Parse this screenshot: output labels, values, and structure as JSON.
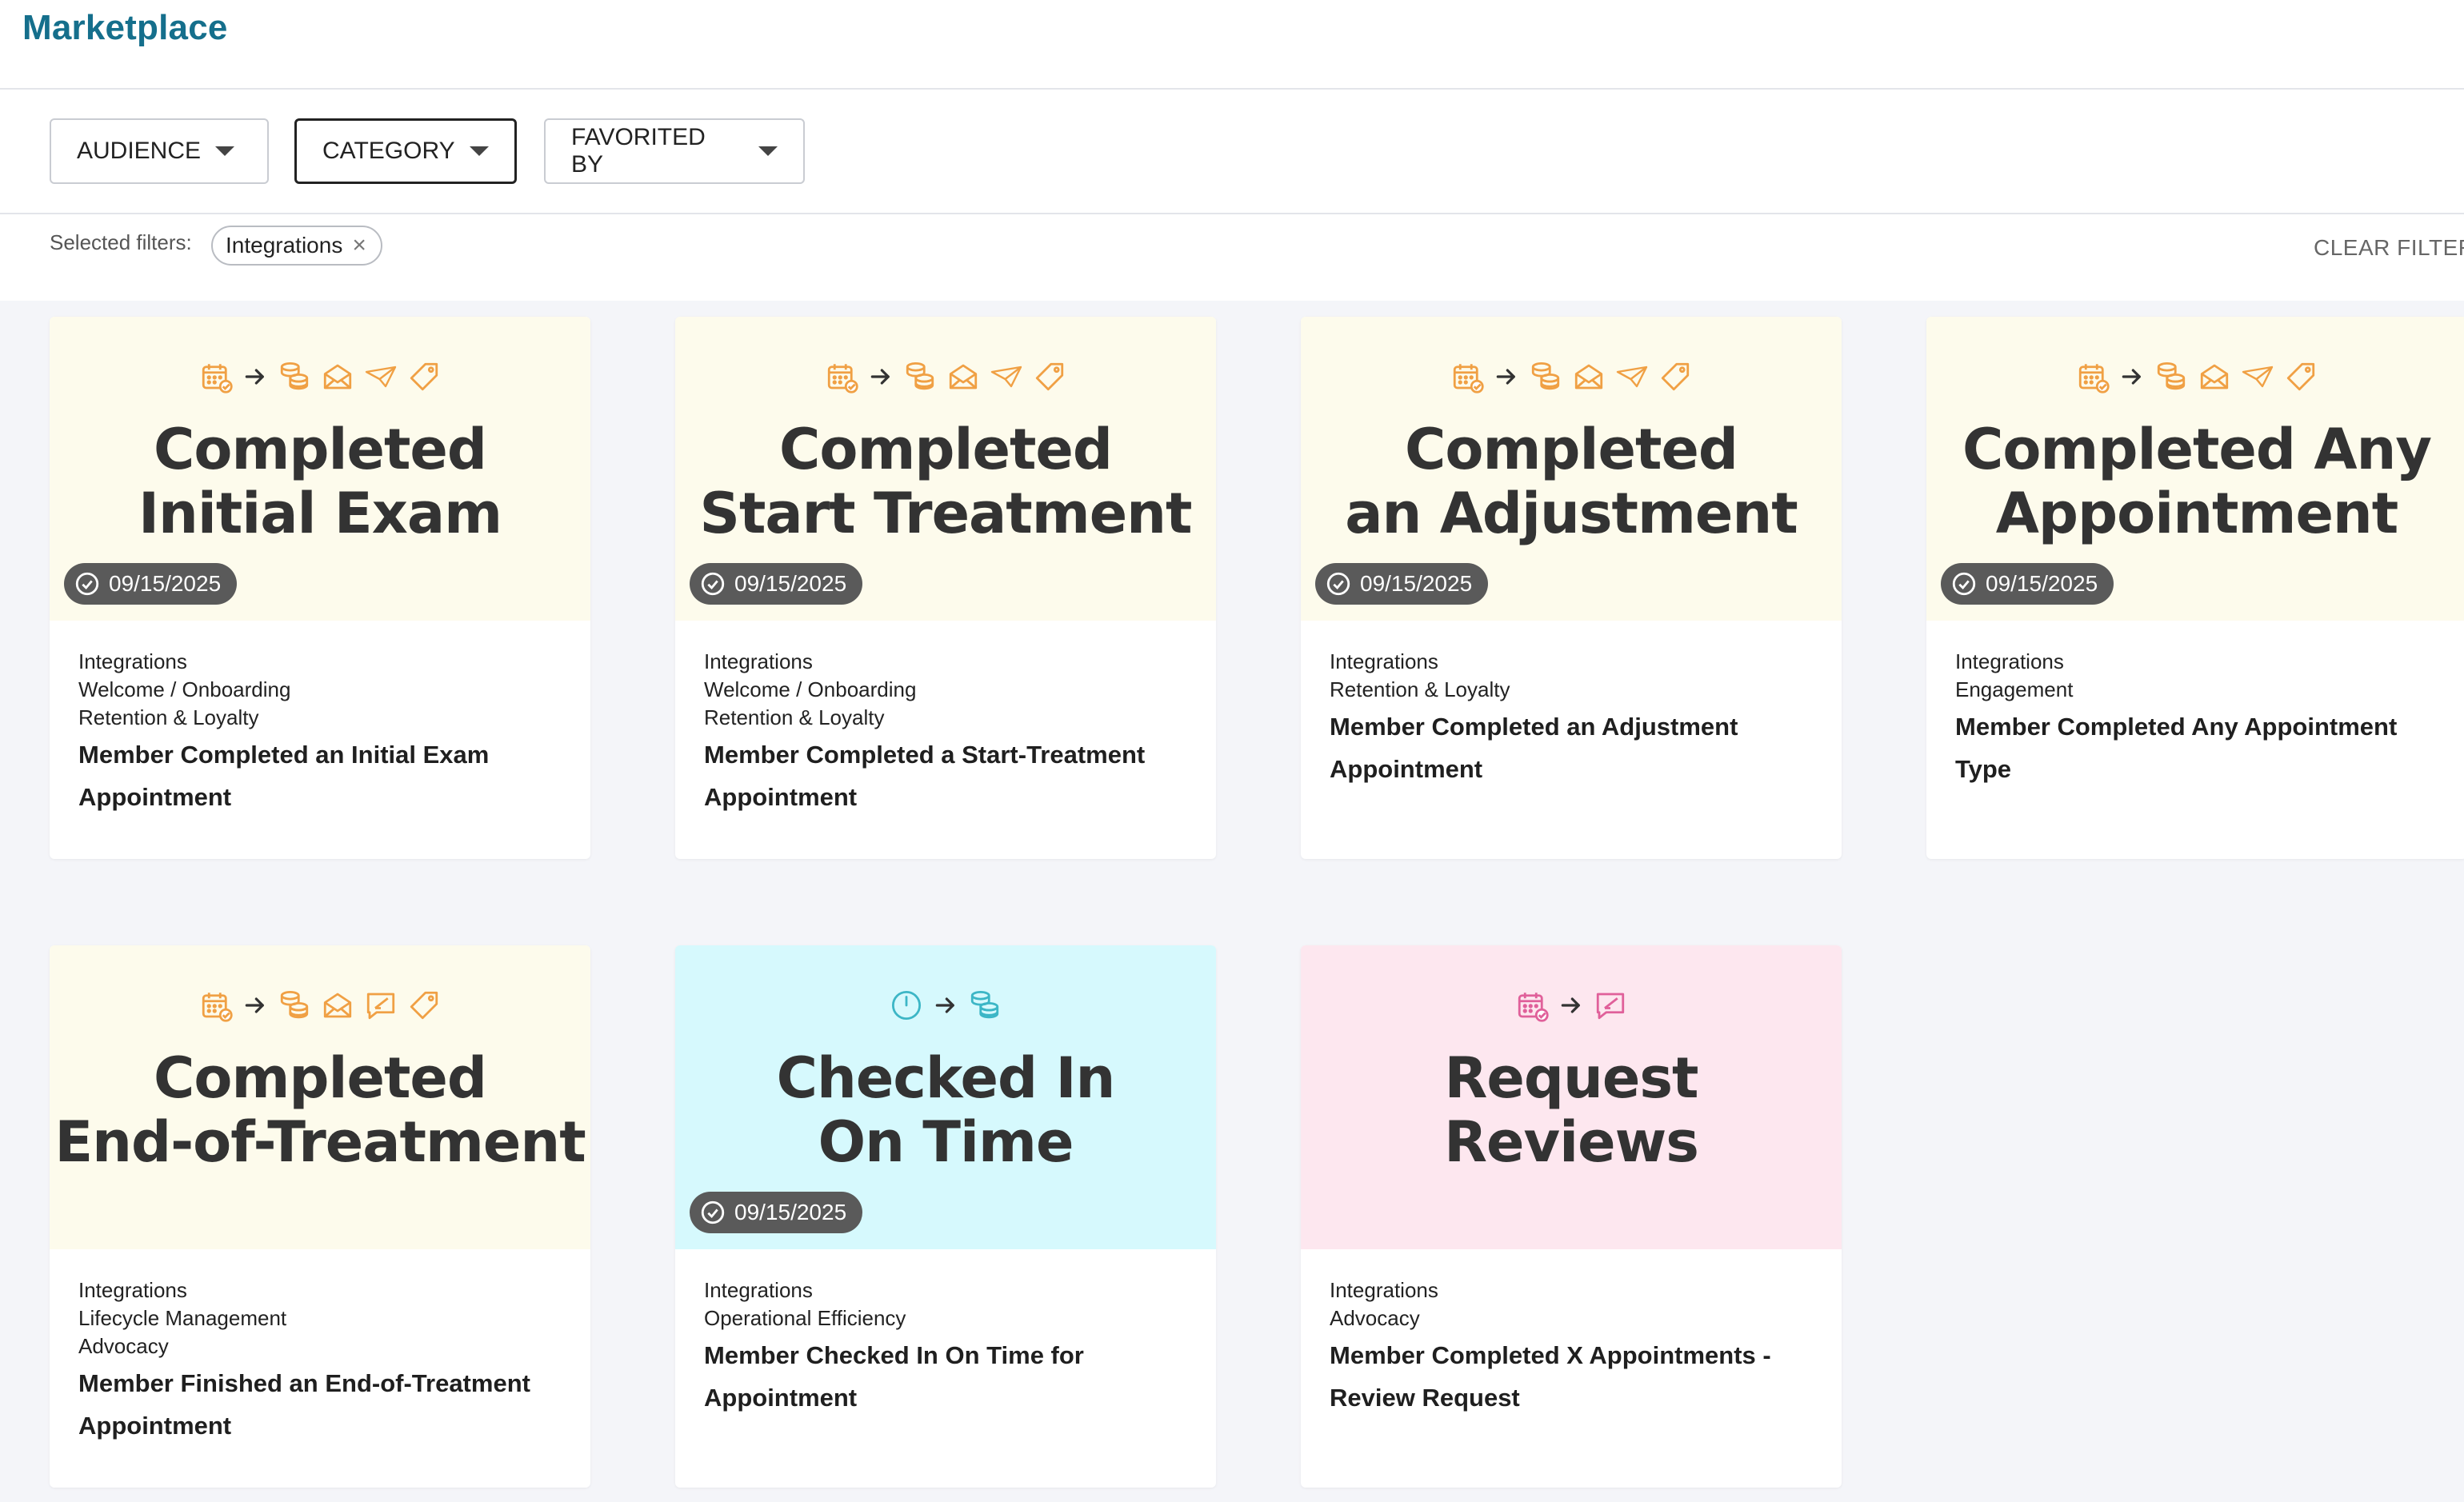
{
  "app": {
    "title": "Marketplace"
  },
  "filters": {
    "audience_label": "AUDIENCE",
    "category_label": "CATEGORY",
    "favorited_label": "FAVORITED BY",
    "selected_label": "Selected filters:",
    "chips": [
      "Integrations"
    ],
    "clear_label": "CLEAR FILTERS"
  },
  "cards": [
    {
      "banner_color": "#fdfbec",
      "icon_color": "#f0a044",
      "icons": [
        "calendar-check-icon",
        "arrow-right-icon",
        "coins-icon",
        "envelope-icon",
        "paper-plane-icon",
        "tag-icon"
      ],
      "headline": [
        "Completed",
        "Initial Exam"
      ],
      "date": "09/15/2025",
      "categories": [
        "Integrations",
        "Welcome / Onboarding",
        "Retention & Loyalty"
      ],
      "title": "Member Completed an Initial Exam Appointment"
    },
    {
      "banner_color": "#fdfbec",
      "icon_color": "#f0a044",
      "icons": [
        "calendar-check-icon",
        "arrow-right-icon",
        "coins-icon",
        "envelope-icon",
        "paper-plane-icon",
        "tag-icon"
      ],
      "headline": [
        "Completed",
        "Start Treatment"
      ],
      "date": "09/15/2025",
      "categories": [
        "Integrations",
        "Welcome / Onboarding",
        "Retention & Loyalty"
      ],
      "title": "Member Completed a Start-Treatment Appointment"
    },
    {
      "banner_color": "#fdfbec",
      "icon_color": "#f0a044",
      "icons": [
        "calendar-check-icon",
        "arrow-right-icon",
        "coins-icon",
        "envelope-icon",
        "paper-plane-icon",
        "tag-icon"
      ],
      "headline": [
        "Completed",
        "an Adjustment"
      ],
      "date": "09/15/2025",
      "categories": [
        "Integrations",
        "Retention & Loyalty"
      ],
      "title": "Member Completed an Adjustment Appointment"
    },
    {
      "banner_color": "#fdfbec",
      "icon_color": "#f0a044",
      "icons": [
        "calendar-check-icon",
        "arrow-right-icon",
        "coins-icon",
        "envelope-icon",
        "paper-plane-icon",
        "tag-icon"
      ],
      "headline": [
        "Completed Any",
        "Appointment"
      ],
      "date": "09/15/2025",
      "categories": [
        "Integrations",
        "Engagement"
      ],
      "title": "Member Completed Any Appointment Type"
    },
    {
      "banner_color": "#fdfbec",
      "icon_color": "#f0a044",
      "icons": [
        "calendar-check-icon",
        "arrow-right-icon",
        "coins-icon",
        "envelope-icon",
        "chat-review-icon",
        "tag-icon"
      ],
      "headline": [
        "Completed",
        "End-of-Treatment"
      ],
      "date": "",
      "categories": [
        "Integrations",
        "Lifecycle Management",
        "Advocacy"
      ],
      "title": "Member Finished an End-of-Treatment Appointment"
    },
    {
      "banner_color": "#d6f9fd",
      "icon_color": "#3cb6c6",
      "icons": [
        "clock-icon",
        "arrow-right-icon",
        "coins-icon"
      ],
      "headline": [
        "Checked In",
        "On Time"
      ],
      "date": "09/15/2025",
      "categories": [
        "Integrations",
        "Operational Efficiency"
      ],
      "title": "Member Checked In On Time for Appointment"
    },
    {
      "banner_color": "#fde7ef",
      "icon_color": "#e0609a",
      "icons": [
        "calendar-check-icon",
        "arrow-right-icon",
        "chat-review-icon"
      ],
      "headline": [
        "Request",
        "Reviews"
      ],
      "date": "",
      "categories": [
        "Integrations",
        "Advocacy"
      ],
      "title": "Member Completed X Appointments - Review Request"
    }
  ]
}
